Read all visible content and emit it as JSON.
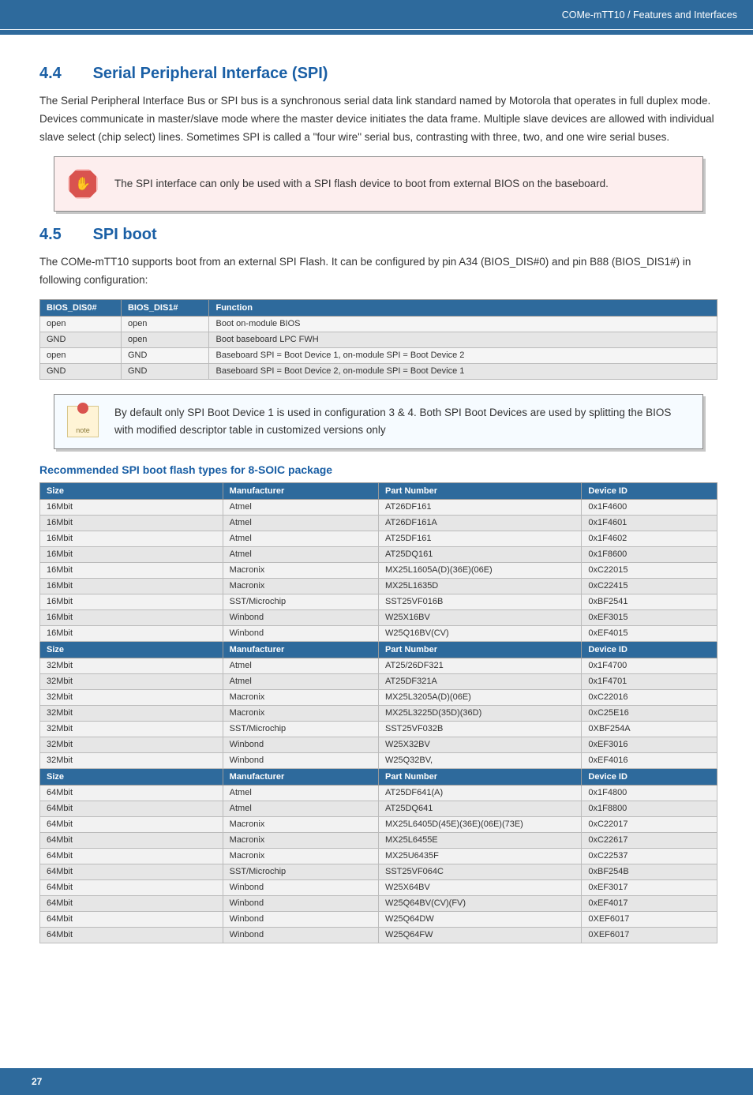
{
  "header": {
    "breadcrumb": "COMe-mTT10 / Features and Interfaces"
  },
  "section44": {
    "num": "4.4",
    "title": "Serial Peripheral Interface (SPI)",
    "para": "The Serial Peripheral Interface Bus or SPI bus is a synchronous serial data link standard named by Motorola that operates in full duplex mode. Devices communicate in master/slave mode where the master device initiates the data frame. Multiple slave devices are allowed with individual slave select (chip select) lines. Sometimes SPI is called a \"four wire\" serial bus, contrasting with three, two, and one wire serial buses.",
    "callout": "The SPI interface can only be used with a SPI flash device to boot from external BIOS on the baseboard."
  },
  "section45": {
    "num": "4.5",
    "title": "SPI boot",
    "para": "The COMe-mTT10 supports boot from an external SPI Flash. It can be configured by pin A34 (BIOS_DIS#0) and pin B88 (BIOS_DIS1#) in following configuration:",
    "note": "By default only SPI Boot Device 1 is used in configuration 3 & 4. Both SPI Boot Devices are used by splitting the BIOS with modified descriptor table in customized versions only"
  },
  "cfg_table": {
    "headers": [
      "BIOS_DIS0#",
      "BIOS_DIS1#",
      "Function"
    ],
    "rows": [
      [
        "open",
        "open",
        "Boot on-module BIOS"
      ],
      [
        "GND",
        "open",
        "Boot baseboard LPC FWH"
      ],
      [
        "open",
        "GND",
        "Baseboard SPI = Boot Device 1, on-module SPI = Boot Device 2"
      ],
      [
        "GND",
        "GND",
        "Baseboard SPI = Boot Device 2, on-module SPI = Boot Device 1"
      ]
    ]
  },
  "flash_heading": "Recommended SPI boot flash types for 8-SOIC package",
  "flash_table": {
    "col_headers": [
      "Size",
      "Manufacturer",
      "Part Number",
      "Device ID"
    ],
    "groups": [
      {
        "rows": [
          [
            "16Mbit",
            "Atmel",
            "AT26DF161",
            "0x1F4600"
          ],
          [
            "16Mbit",
            "Atmel",
            "AT26DF161A",
            "0x1F4601"
          ],
          [
            "16Mbit",
            "Atmel",
            "AT25DF161",
            "0x1F4602"
          ],
          [
            "16Mbit",
            "Atmel",
            "AT25DQ161",
            "0x1F8600"
          ],
          [
            "16Mbit",
            "Macronix",
            "MX25L1605A(D)(36E)(06E)",
            "0xC22015"
          ],
          [
            "16Mbit",
            "Macronix",
            "MX25L1635D",
            "0xC22415"
          ],
          [
            "16Mbit",
            "SST/Microchip",
            "SST25VF016B",
            "0xBF2541"
          ],
          [
            "16Mbit",
            "Winbond",
            "W25X16BV",
            "0xEF3015"
          ],
          [
            "16Mbit",
            "Winbond",
            "W25Q16BV(CV)",
            "0xEF4015"
          ]
        ]
      },
      {
        "rows": [
          [
            "32Mbit",
            "Atmel",
            "AT25/26DF321",
            "0x1F4700"
          ],
          [
            "32Mbit",
            "Atmel",
            "AT25DF321A",
            "0x1F4701"
          ],
          [
            "32Mbit",
            "Macronix",
            "MX25L3205A(D)(06E)",
            "0xC22016"
          ],
          [
            "32Mbit",
            "Macronix",
            "MX25L3225D(35D)(36D)",
            "0xC25E16"
          ],
          [
            "32Mbit",
            "SST/Microchip",
            "SST25VF032B",
            "0XBF254A"
          ],
          [
            "32Mbit",
            "Winbond",
            "W25X32BV",
            "0xEF3016"
          ],
          [
            "32Mbit",
            "Winbond",
            "W25Q32BV,",
            "0xEF4016"
          ]
        ]
      },
      {
        "rows": [
          [
            "64Mbit",
            "Atmel",
            "AT25DF641(A)",
            "0x1F4800"
          ],
          [
            "64Mbit",
            "Atmel",
            "AT25DQ641",
            "0x1F8800"
          ],
          [
            "64Mbit",
            "Macronix",
            "MX25L6405D(45E)(36E)(06E)(73E)",
            "0xC22017"
          ],
          [
            "64Mbit",
            "Macronix",
            "MX25L6455E",
            "0xC22617"
          ],
          [
            "64Mbit",
            "Macronix",
            "MX25U6435F",
            "0xC22537"
          ],
          [
            "64Mbit",
            "SST/Microchip",
            "SST25VF064C",
            "0xBF254B"
          ],
          [
            "64Mbit",
            "Winbond",
            "W25X64BV",
            "0xEF3017"
          ],
          [
            "64Mbit",
            "Winbond",
            "W25Q64BV(CV)(FV)",
            "0xEF4017"
          ],
          [
            "64Mbit",
            "Winbond",
            "W25Q64DW",
            "0XEF6017"
          ],
          [
            "64Mbit",
            "Winbond",
            "W25Q64FW",
            "0XEF6017"
          ]
        ]
      }
    ]
  },
  "footer": {
    "page_num": "27"
  }
}
